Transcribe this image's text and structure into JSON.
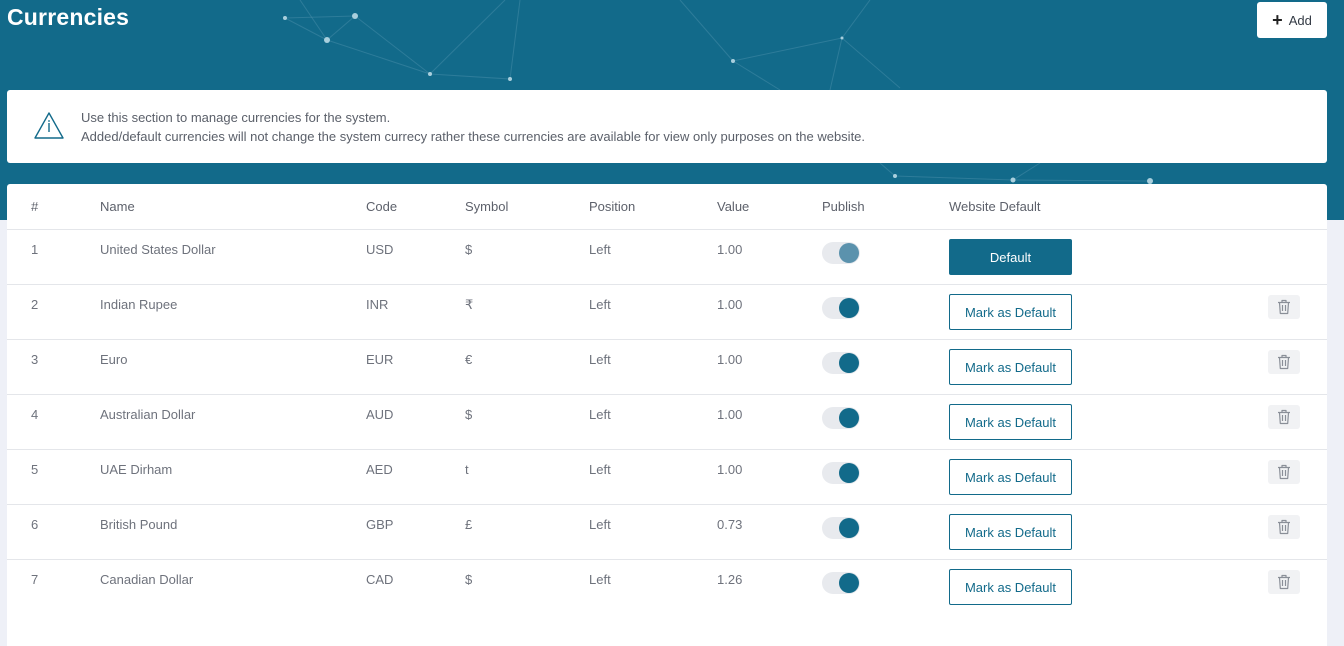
{
  "page": {
    "title": "Currencies",
    "add_label": "Add"
  },
  "info": {
    "line1": "Use this section to manage currencies for the system.",
    "line2": "Added/default currencies will not change the system currecy rather these currencies are available for view only purposes on the website."
  },
  "table": {
    "headers": {
      "index": "#",
      "name": "Name",
      "code": "Code",
      "symbol": "Symbol",
      "position": "Position",
      "value": "Value",
      "publish": "Publish",
      "website_default": "Website Default"
    },
    "rows": [
      {
        "index": "1",
        "name": "United States Dollar",
        "code": "USD",
        "symbol": "$",
        "position": "Left",
        "value": "1.00",
        "published": true,
        "is_default": true,
        "action_label": "Default"
      },
      {
        "index": "2",
        "name": "Indian Rupee",
        "code": "INR",
        "symbol": "₹",
        "position": "Left",
        "value": "1.00",
        "published": true,
        "is_default": false,
        "action_label": "Mark as Default"
      },
      {
        "index": "3",
        "name": "Euro",
        "code": "EUR",
        "symbol": "€",
        "position": "Left",
        "value": "1.00",
        "published": true,
        "is_default": false,
        "action_label": "Mark as Default"
      },
      {
        "index": "4",
        "name": "Australian Dollar",
        "code": "AUD",
        "symbol": "$",
        "position": "Left",
        "value": "1.00",
        "published": true,
        "is_default": false,
        "action_label": "Mark as Default"
      },
      {
        "index": "5",
        "name": "UAE Dirham",
        "code": "AED",
        "symbol": "t",
        "position": "Left",
        "value": "1.00",
        "published": true,
        "is_default": false,
        "action_label": "Mark as Default"
      },
      {
        "index": "6",
        "name": "British Pound",
        "code": "GBP",
        "symbol": "£",
        "position": "Left",
        "value": "0.73",
        "published": true,
        "is_default": false,
        "action_label": "Mark as Default"
      },
      {
        "index": "7",
        "name": "Canadian Dollar",
        "code": "CAD",
        "symbol": "$",
        "position": "Left",
        "value": "1.26",
        "published": true,
        "is_default": false,
        "action_label": "Mark as Default"
      }
    ]
  },
  "colors": {
    "brand": "#126a8a",
    "page_bg": "#eef0f7"
  }
}
